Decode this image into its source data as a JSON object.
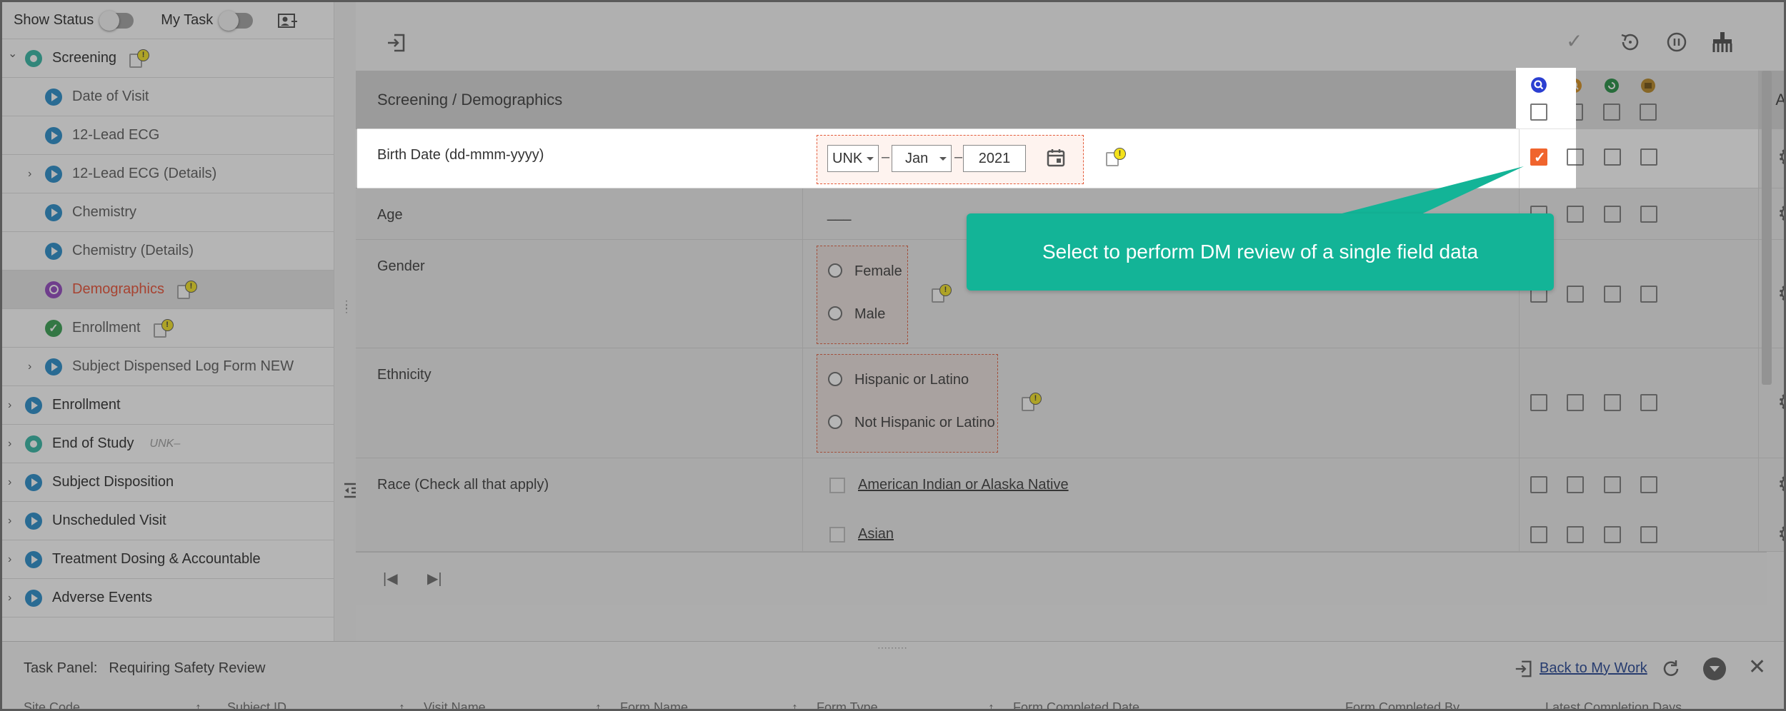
{
  "sidebar": {
    "show_status": "Show Status",
    "my_task": "My Task",
    "items": [
      {
        "label": "Screening",
        "level": 0,
        "expanded": true,
        "status": "teal",
        "warn": true
      },
      {
        "label": "Date of Visit",
        "level": 1,
        "status": "blue"
      },
      {
        "label": "12-Lead ECG",
        "level": 1,
        "status": "blue"
      },
      {
        "label": "12-Lead ECG (Details)",
        "level": 1,
        "status": "blue",
        "collapsed": true
      },
      {
        "label": "Chemistry",
        "level": 1,
        "status": "blue"
      },
      {
        "label": "Chemistry (Details)",
        "level": 1,
        "status": "blue"
      },
      {
        "label": "Demographics",
        "level": 1,
        "status": "purple",
        "warn": true,
        "active": true
      },
      {
        "label": "Enrollment",
        "level": 1,
        "status": "green",
        "warn": true
      },
      {
        "label": "Subject Dispensed Log Form NEW",
        "level": 1,
        "status": "blue",
        "collapsed": true
      },
      {
        "label": "Enrollment",
        "level": 0,
        "status": "blue",
        "collapsed": true
      },
      {
        "label": "End of Study",
        "level": 0,
        "status": "teal",
        "collapsed": true,
        "note": "UNK–"
      },
      {
        "label": "Subject Disposition",
        "level": 0,
        "status": "blue",
        "collapsed": true
      },
      {
        "label": "Unscheduled Visit",
        "level": 0,
        "status": "blue",
        "collapsed": true
      },
      {
        "label": "Treatment Dosing & Accountable",
        "level": 0,
        "status": "blue",
        "collapsed": true
      },
      {
        "label": "Adverse Events",
        "level": 0,
        "status": "blue",
        "collapsed": true
      }
    ]
  },
  "form": {
    "breadcrumb": "Screening / Demographics",
    "action_header": "Action",
    "birth_date": {
      "label": "Birth Date (dd-mmm-yyyy)",
      "day": "UNK",
      "month": "Jan",
      "year": "2021",
      "sep": "–"
    },
    "age": {
      "label": "Age",
      "value": "___"
    },
    "gender": {
      "label": "Gender",
      "options": [
        "Female",
        "Male"
      ]
    },
    "ethnicity": {
      "label": "Ethnicity",
      "options": [
        "Hispanic or Latino",
        "Not Hispanic or Latino"
      ]
    },
    "race": {
      "label": "Race (Check all that apply)",
      "options": [
        "American Indian or Alaska Native",
        "Asian"
      ]
    }
  },
  "callout": {
    "text": "Select to perform DM review of a single field data"
  },
  "task_panel": {
    "title": "Task Panel:",
    "filter": "Requiring Safety Review",
    "back_link": "Back to My Work",
    "columns": [
      "Site Code",
      "Subject ID",
      "Visit Name",
      "Form Name",
      "Form Type",
      "Form Completed Date",
      "Form Completed By",
      "Latest Completion Days"
    ]
  },
  "colors": {
    "accent_orange": "#f0642d",
    "callout_teal": "#13b497",
    "active_item": "#e8472b",
    "link_blue": "#1a3d8f"
  },
  "review_icons": [
    "dm-review-icon",
    "sdv-icon",
    "medical-review-icon",
    "freeze-icon"
  ]
}
